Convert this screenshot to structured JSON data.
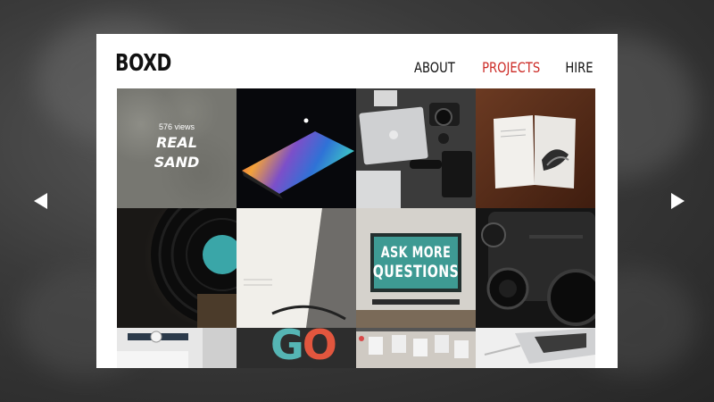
{
  "site": {
    "logo": "BOXD",
    "nav": [
      {
        "label": "ABOUT",
        "active": false
      },
      {
        "label": "PROJECTS",
        "active": true
      },
      {
        "label": "HIRE",
        "active": false
      }
    ]
  },
  "tiles": [
    {
      "id": "real-sand",
      "views": "576 views",
      "title_line1": "REAL",
      "title_line2": "SAND"
    },
    {
      "id": "rainbow-laptop"
    },
    {
      "id": "desk-gear"
    },
    {
      "id": "open-book"
    },
    {
      "id": "vinyl-record"
    },
    {
      "id": "magazine"
    },
    {
      "id": "ask-more-questions",
      "poster_line1": "ASK MORE",
      "poster_line2": "QUESTIONS"
    },
    {
      "id": "camera"
    },
    {
      "id": "watch-keyboard"
    },
    {
      "id": "go-sign",
      "sign_text_g": "G",
      "sign_text_o": "O"
    },
    {
      "id": "pinboard"
    },
    {
      "id": "macbook"
    }
  ],
  "controls": {
    "prev_icon": "left-arrow-icon",
    "next_icon": "right-arrow-icon"
  },
  "colors": {
    "accent": "#cc2a25",
    "background": "#2e2e2e",
    "poster_teal": "#3e9a93"
  }
}
